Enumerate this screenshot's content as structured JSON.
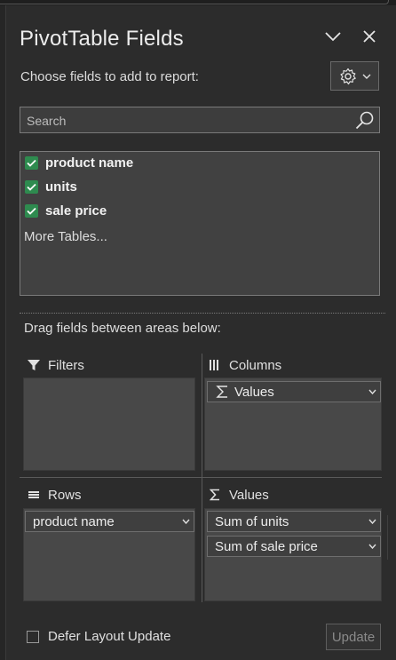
{
  "header": {
    "title": "PivotTable Fields",
    "subtitle": "Choose fields to add to report:",
    "icons": {
      "collapse": "chevron-down-icon",
      "close": "close-icon",
      "settings": "gear-icon"
    }
  },
  "search": {
    "placeholder": "Search",
    "value": ""
  },
  "fields": [
    {
      "label": "product name",
      "checked": true
    },
    {
      "label": "units",
      "checked": true
    },
    {
      "label": "sale price",
      "checked": true
    }
  ],
  "more_tables": "More Tables...",
  "drag_hint": "Drag fields between areas below:",
  "areas": {
    "filters": {
      "label": "Filters",
      "items": []
    },
    "columns": {
      "label": "Columns",
      "items": [
        {
          "label": "Values",
          "icon": "sigma-icon"
        }
      ]
    },
    "rows": {
      "label": "Rows",
      "items": [
        {
          "label": "product name"
        }
      ]
    },
    "values": {
      "label": "Values",
      "items": [
        {
          "label": "Sum of units"
        },
        {
          "label": "Sum of sale price"
        }
      ]
    }
  },
  "footer": {
    "defer_label": "Defer Layout Update",
    "defer_checked": false,
    "update_label": "Update",
    "update_enabled": false
  },
  "colors": {
    "checkbox_accent": "#2e8b4f",
    "background": "#2c2c2c",
    "area_fill": "#484848"
  }
}
